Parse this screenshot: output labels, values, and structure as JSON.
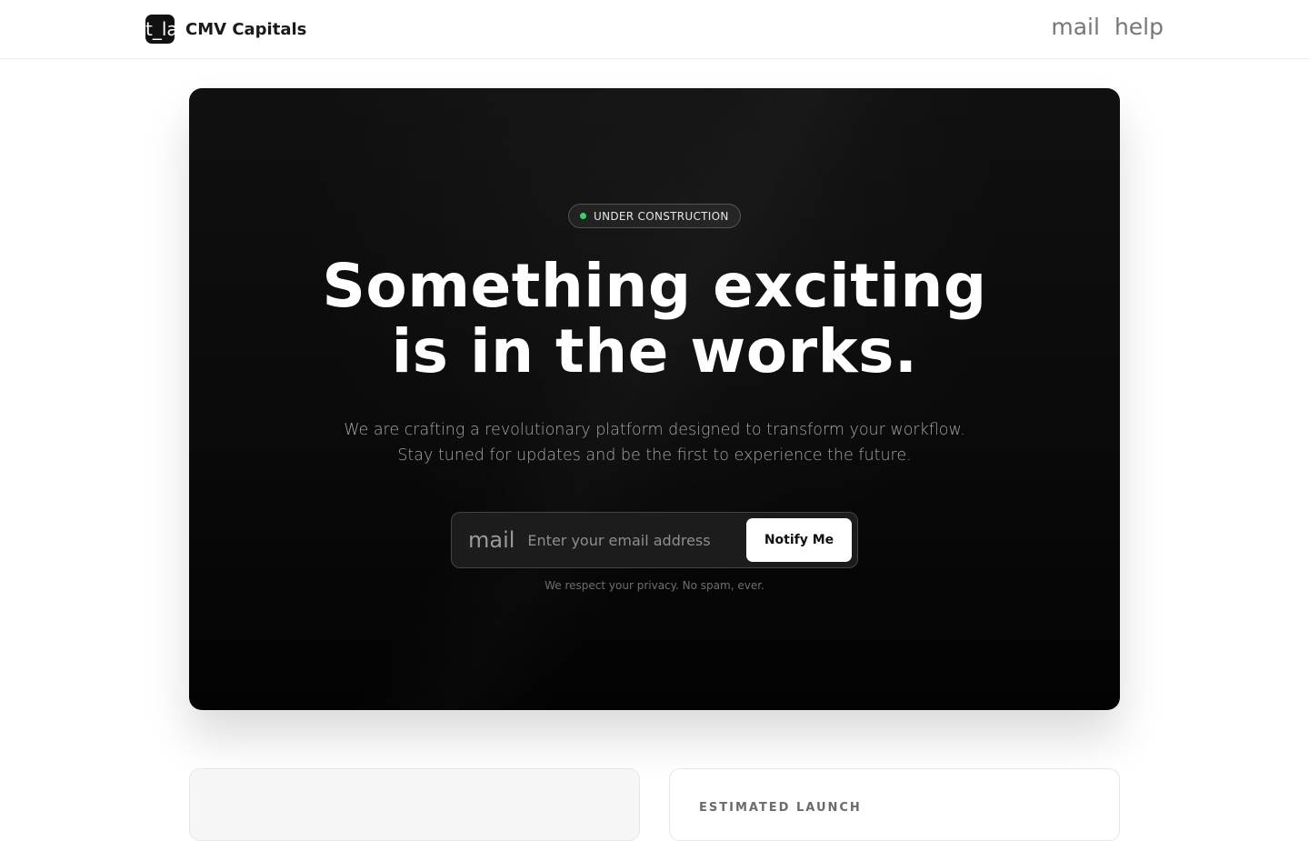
{
  "header": {
    "logo_text": "t_la",
    "brand_name": "CMV Capitals",
    "nav": {
      "mail_label": "mail",
      "help_label": "help"
    }
  },
  "hero": {
    "badge_text": "UNDER CONSTRUCTION",
    "badge_dot_color": "#3ecf6b",
    "headline_line1": "Something exciting",
    "headline_line2": "is in the works.",
    "subtext": "We are crafting a revolutionary platform designed to transform your workflow. Stay tuned for updates and be the first to experience the future.",
    "form": {
      "icon_text": "mail",
      "email_placeholder": "Enter your email address",
      "email_value": "",
      "button_label": "Notify Me"
    },
    "privacy_note": "We respect your privacy. No spam, ever."
  },
  "cards": {
    "right_label": "ESTIMATED LAUNCH"
  },
  "colors": {
    "hero_background": "#0b0b0b",
    "accent_button": "#ffffff",
    "brand_text": "#1a1a1a"
  }
}
